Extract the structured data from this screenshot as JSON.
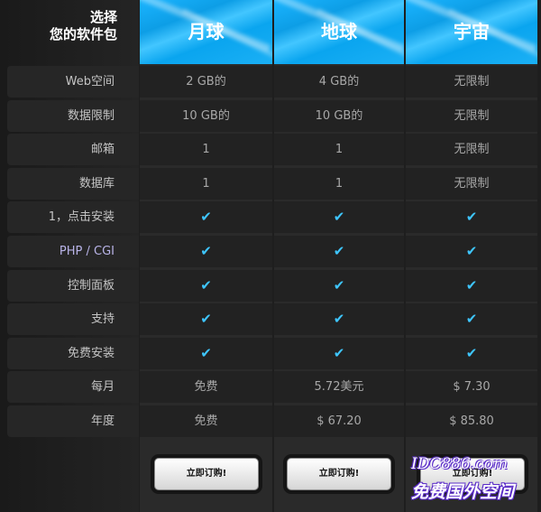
{
  "corner": {
    "line1": "选择",
    "line2": "您的软件包"
  },
  "plans": [
    {
      "name": "月球"
    },
    {
      "name": "地球"
    },
    {
      "name": "宇宙"
    }
  ],
  "features": [
    {
      "label": "Web空间",
      "values": [
        "2 GB的",
        "4 GB的",
        "无限制"
      ]
    },
    {
      "label": "数据限制",
      "values": [
        "10 GB的",
        "10 GB的",
        "无限制"
      ]
    },
    {
      "label": "邮箱",
      "values": [
        "1",
        "1",
        "无限制"
      ]
    },
    {
      "label": "数据库",
      "values": [
        "1",
        "1",
        "无限制"
      ]
    },
    {
      "label": "1，点击安装",
      "values": [
        "✔",
        "✔",
        "✔"
      ]
    },
    {
      "label": "PHP / CGI",
      "values": [
        "✔",
        "✔",
        "✔"
      ]
    },
    {
      "label": "控制面板",
      "values": [
        "✔",
        "✔",
        "✔"
      ]
    },
    {
      "label": "支持",
      "values": [
        "✔",
        "✔",
        "✔"
      ]
    },
    {
      "label": "免费安装",
      "values": [
        "✔",
        "✔",
        "✔"
      ]
    },
    {
      "label": "每月",
      "values": [
        "免费",
        "5.72美元",
        "$ 7.30"
      ]
    },
    {
      "label": "年度",
      "values": [
        "免费",
        "$ 67.20",
        "$ 85.80"
      ]
    }
  ],
  "order_label": "立即订购!",
  "watermark": {
    "line1": "IDC886.com",
    "line2": "免费国外空间"
  },
  "colors": {
    "accent": "#1ab4ff",
    "check": "#3ec6ff",
    "background": "#1e1e1e"
  }
}
